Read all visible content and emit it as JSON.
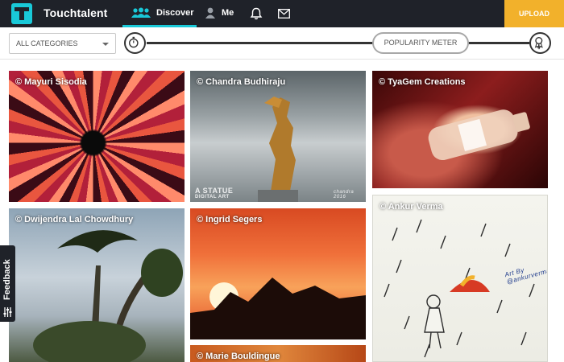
{
  "nav": {
    "brand": "Touchtalent",
    "discover_label": "Discover",
    "me_label": "Me",
    "upload_label": "UPLOAD",
    "icons": [
      "logo-icon",
      "people-icon",
      "person-icon",
      "bell-icon",
      "mail-icon"
    ]
  },
  "filters": {
    "category_selected": "ALL CATEGORIES",
    "meter_label": "POPULARITY METER",
    "icons": [
      "stopwatch-icon",
      "award-icon"
    ]
  },
  "gallery": {
    "cards": [
      {
        "credit": "© Mayuri Sisodia"
      },
      {
        "credit": "© Chandra Budhiraju",
        "overlay": "A STATUE",
        "overlay2": "DIGITAL ART",
        "signature": "chandra 2016"
      },
      {
        "credit": "© TyaGem Creations"
      },
      {
        "credit": "© Dwijendra Lal Chowdhury"
      },
      {
        "credit": "© Ingrid Segers"
      },
      {
        "credit": "© Ankur Verma",
        "signature": "Art By @ankurverma"
      },
      {
        "credit": "© Marie Bouldingue"
      }
    ]
  },
  "feedback": {
    "label": "Feedback"
  },
  "colors": {
    "topbar": "#1f2229",
    "accent": "#19c9d8",
    "upload": "#f2b12b"
  }
}
